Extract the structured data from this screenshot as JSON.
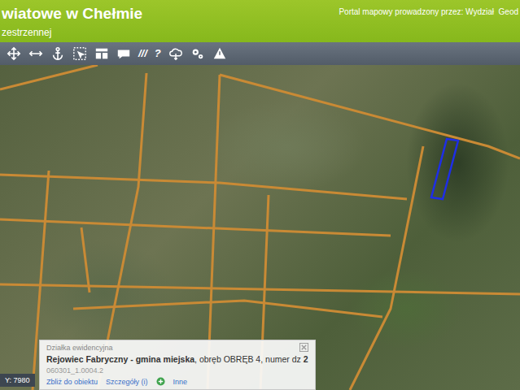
{
  "header": {
    "title": "wiatowe w Chełmie",
    "subtitle": "zestrzennej",
    "operator": "Portal mapowy prowadzony przez: Wydział  Geod"
  },
  "toolbar": {
    "tools": [
      {
        "kind": "move"
      },
      {
        "kind": "width"
      },
      {
        "kind": "anchor"
      },
      {
        "kind": "select"
      },
      {
        "kind": "layout"
      },
      {
        "kind": "chat"
      },
      {
        "kind": "text",
        "label": "///"
      },
      {
        "kind": "text",
        "label": "?"
      },
      {
        "kind": "cloud"
      },
      {
        "kind": "gears"
      },
      {
        "kind": "warning"
      }
    ]
  },
  "coordinates": {
    "label": "Y: 7980"
  },
  "popup": {
    "heading": "Działka ewidencyjna",
    "place": "Rejowiec Fabryczny - gmina miejska",
    "detail": ", obręb OBRĘB 4, numer dz ",
    "number": "2",
    "id": "060301_1.0004.2",
    "links": [
      "Zbliż do obiektu",
      "Szczegóły (i)"
    ],
    "more": "Inne"
  }
}
